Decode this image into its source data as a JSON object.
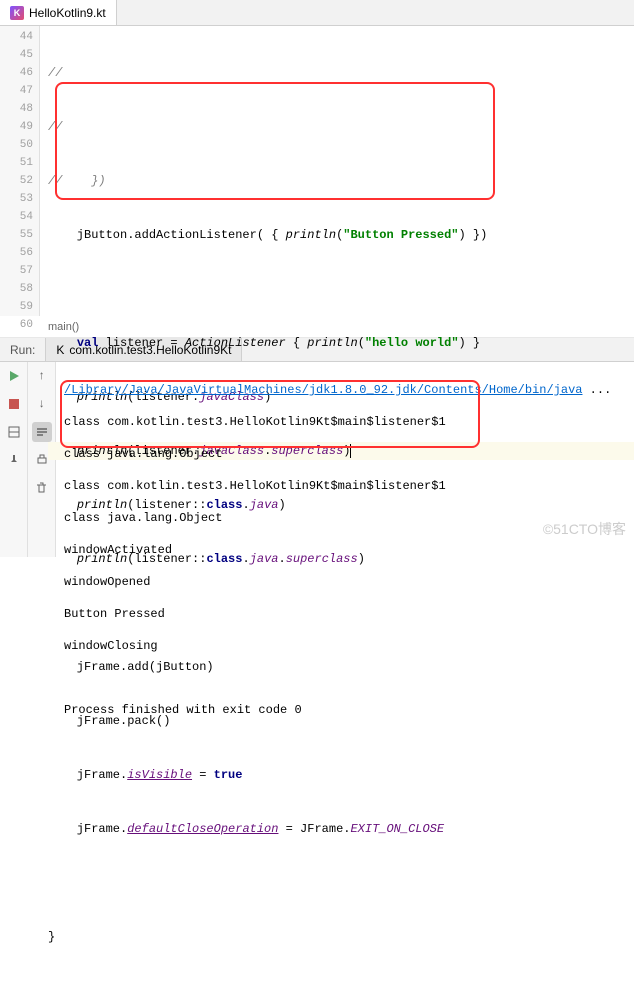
{
  "tab": {
    "filename": "HelloKotlin9.kt"
  },
  "gutter": [
    "44",
    "45",
    "46",
    "47",
    "48",
    "49",
    "50",
    "51",
    "52",
    "53",
    "54",
    "55",
    "56",
    "57",
    "58",
    "59",
    "60"
  ],
  "code": {
    "l44": "//",
    "l45": "//",
    "l46": "//    })",
    "l47a": "    jButton.addActionListener( { ",
    "l47b": "println",
    "l47c": "(",
    "l47d": "\"Button Pressed\"",
    "l47e": ") })",
    "l49a": "    ",
    "l49b": "val",
    "l49c": " listener = ",
    "l49d": "ActionListener",
    "l49e": " { ",
    "l49f": "println",
    "l49g": "(",
    "l49h": "\"hello world\"",
    "l49i": ") }",
    "l50a": "    ",
    "l50b": "println",
    "l50c": "(listener.",
    "l50d": "javaClass",
    "l50e": ")",
    "l51a": "    ",
    "l51b": "println",
    "l51c": "(listener.",
    "l51d": "javaClass",
    "l51e": ".",
    "l51f": "superclass",
    "l51g": ")",
    "l52a": "    ",
    "l52b": "println",
    "l52c": "(listener::",
    "l52d": "class",
    "l52e": ".",
    "l52f": "java",
    "l52g": ")",
    "l53a": "    ",
    "l53b": "println",
    "l53c": "(listener::",
    "l53d": "class",
    "l53e": ".",
    "l53f": "java",
    "l53g": ".",
    "l53h": "superclass",
    "l53i": ")",
    "l55": "    jFrame.add(jButton)",
    "l56": "    jFrame.pack()",
    "l57a": "    jFrame.",
    "l57b": "isVisible",
    "l57c": " = ",
    "l57d": "true",
    "l58a": "    jFrame.",
    "l58b": "defaultCloseOperation",
    "l58c": " = JFrame.",
    "l58d": "EXIT_ON_CLOSE",
    "l60": "}"
  },
  "breadcrumb": "main()",
  "run": {
    "label": "Run:",
    "tab": "com.kotlin.test3.HelloKotlin9Kt"
  },
  "console": {
    "l1a": "/Library/Java/JavaVirtualMachines/jdk1.8.0_92.jdk/Contents/Home/bin/java",
    "l1b": " ...",
    "l2": "class com.kotlin.test3.HelloKotlin9Kt$main$listener$1",
    "l3": "class java.lang.Object",
    "l4": "class com.kotlin.test3.HelloKotlin9Kt$main$listener$1",
    "l5": "class java.lang.Object",
    "l6": "windowActivated",
    "l7": "windowOpened",
    "l8": "Button Pressed",
    "l9": "windowClosing",
    "l10": "Process finished with exit code 0"
  },
  "watermark": "©51CTO博客"
}
